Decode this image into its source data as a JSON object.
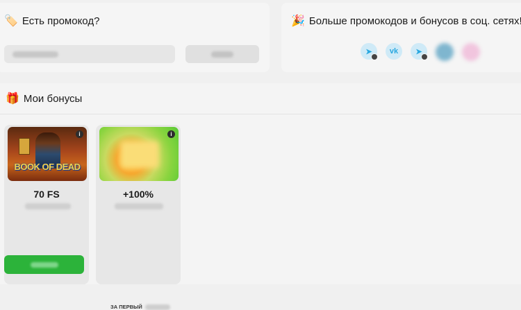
{
  "promo": {
    "emoji": "🏷️",
    "title": "Есть промокод?"
  },
  "social": {
    "emoji": "🎉",
    "title": "Больше промокодов и бонусов в соц. сетях!",
    "icons": [
      "telegram-icon",
      "vk-icon",
      "telegram-icon",
      "blurred-icon",
      "blurred-icon"
    ]
  },
  "bonuses": {
    "emoji": "🎁",
    "title": "Мои бонусы",
    "cards": [
      {
        "image_text": "BOOK OF DEAD",
        "value": "70 FS"
      },
      {
        "value": "+100%",
        "footer": "ЗА ПЕРВЫЙ"
      }
    ]
  },
  "colors": {
    "accent_green": "#2cb33a",
    "telegram_blue": "#29a8e0"
  }
}
